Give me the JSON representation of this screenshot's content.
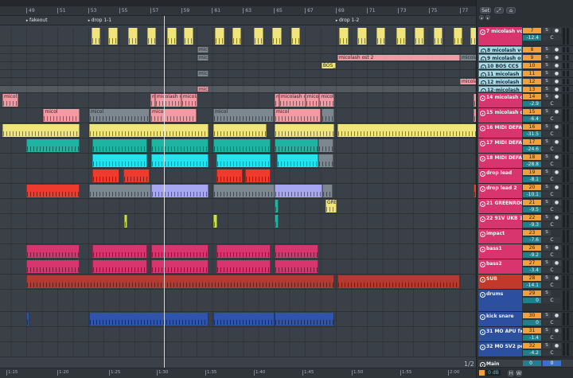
{
  "colors": {
    "yellow": "#f0e57a",
    "gray": "#7d8790",
    "pink": "#f49aa4",
    "teal": "#1db5a2",
    "cyan": "#22e3ef",
    "red": "#ef3b2e",
    "lavender": "#a7a6f0",
    "darkred": "#b33b2f",
    "blue": "#2f54aa",
    "lime": "#c8e04a",
    "hdr_pink": "#d8356f",
    "hdr_lightblue": "#a8dce9",
    "hdr_red": "#c0392b",
    "hdr_blue": "#2d4fa0"
  },
  "ruler": {
    "bars": [
      "49",
      "51",
      "53",
      "55",
      "57",
      "59",
      "61",
      "63",
      "65",
      "67",
      "69",
      "71",
      "73",
      "75",
      "77"
    ]
  },
  "locators": [
    {
      "name": "fakeout",
      "bar": 49.2
    },
    {
      "name": "drop 1-1",
      "bar": 53.2
    },
    {
      "name": "drop 1-2",
      "bar": 69.2
    }
  ],
  "timebar": {
    "labels": [
      "1:15",
      "1:20",
      "1:25",
      "1:30",
      "1:35",
      "1:40",
      "1:45",
      "1:50",
      "1:55",
      "2:00"
    ],
    "zoom": "1/2"
  },
  "panel": {
    "set_label": "Set",
    "expand_icon": "expand-icon",
    "lock_icon": "lock-icon",
    "nav_left": "◂",
    "nav_right": "▸"
  },
  "tracks": [
    {
      "name": "7 micolash voic",
      "num": "7",
      "vol": "-12.4",
      "pan": "C",
      "color": "hdr_pink",
      "fold": "down"
    },
    {
      "name": "8 micolash voic",
      "num": "8",
      "color": "hdr_lightblue",
      "fold": "right"
    },
    {
      "name": "9 micolash ost",
      "num": "9",
      "color": "hdr_lightblue",
      "fold": "right"
    },
    {
      "name": "10 BOS  CCS  12",
      "num": "10",
      "color": "hdr_lightblue",
      "fold": "right"
    },
    {
      "name": "11 micolash ost",
      "num": "11",
      "color": "hdr_lightblue",
      "fold": "right"
    },
    {
      "name": "12 micolash ost",
      "num": "12",
      "color": "hdr_lightblue",
      "fold": "right"
    },
    {
      "name": "12-micolash os",
      "num": "13",
      "color": "hdr_lightblue",
      "fold": "right"
    },
    {
      "name": "14 micolash ost",
      "num": "14",
      "vol": "-2.9",
      "pan": "C",
      "color": "hdr_pink",
      "fold": "down"
    },
    {
      "name": "15 micolash ost",
      "num": "15",
      "vol": "-6.4",
      "pan": "C",
      "color": "hdr_pink",
      "fold": "down"
    },
    {
      "name": "16 MIDI DEFAUL",
      "num": "16",
      "vol": "-31.5",
      "pan": "C",
      "color": "hdr_pink",
      "fold": "down"
    },
    {
      "name": "17 MIDI DEFAUL",
      "num": "17",
      "vol": "-24.6",
      "pan": "C",
      "color": "hdr_pink",
      "fold": "down"
    },
    {
      "name": "18 MIDI DEFAUL",
      "num": "18",
      "vol": "-28.8",
      "pan": "C",
      "color": "hdr_pink",
      "fold": "down"
    },
    {
      "name": "drop lead",
      "num": "19",
      "vol": "-8.1",
      "pan": "C",
      "color": "hdr_pink",
      "fold": "down"
    },
    {
      "name": "drop lead 2",
      "num": "20",
      "vol": "-10.1",
      "pan": "C",
      "color": "hdr_pink",
      "fold": "down"
    },
    {
      "name": "21 GREENROOM",
      "num": "21",
      "vol": "-9.5",
      "pan": "C",
      "color": "hdr_pink",
      "fold": "down"
    },
    {
      "name": "22 91V  UKB  14",
      "num": "22",
      "vol": "-9.3",
      "pan": "C",
      "color": "hdr_pink",
      "fold": "down"
    },
    {
      "name": "impact",
      "num": "23",
      "vol": "-7.6",
      "pan": "C",
      "color": "hdr_pink",
      "fold": "down",
      "noarm": true
    },
    {
      "name": "bass1",
      "num": "26",
      "vol": "-9.2",
      "pan": "C",
      "color": "hdr_pink",
      "fold": "down"
    },
    {
      "name": "bass2",
      "num": "27",
      "vol": "-3.4",
      "pan": "C",
      "color": "hdr_pink",
      "fold": "down"
    },
    {
      "name": "SUB",
      "num": "28",
      "vol": "-14.1",
      "pan": "C",
      "color": "hdr_red",
      "fold": "down"
    },
    {
      "name": "drums",
      "num": "29",
      "vol": "0",
      "pan": "C",
      "color": "hdr_blue",
      "fold": "down",
      "noarm": true
    },
    {
      "name": "kick snare",
      "num": "30",
      "vol": "0",
      "pan": "C",
      "color": "hdr_blue",
      "fold": "down"
    },
    {
      "name": "31 MO  APU  fx",
      "num": "31",
      "vol": "-1.4",
      "pan": "C",
      "color": "hdr_blue",
      "fold": "down"
    },
    {
      "name": "32 MO  SV2  pe",
      "num": "32",
      "vol": "-4.2",
      "pan": "C",
      "color": "hdr_blue",
      "fold": "down"
    }
  ],
  "main": {
    "name": "Main",
    "vol": "0",
    "pan": "0"
  },
  "footer": {
    "gain": "0 dB",
    "h": "H",
    "w": "W"
  },
  "clips": [
    {
      "t": 0,
      "s": 53.2,
      "l": 0.6,
      "c": "yellow"
    },
    {
      "t": 0,
      "s": 54.3,
      "l": 0.6,
      "c": "yellow"
    },
    {
      "t": 0,
      "s": 55.6,
      "l": 0.6,
      "c": "yellow"
    },
    {
      "t": 0,
      "s": 56.8,
      "l": 0.6,
      "c": "yellow"
    },
    {
      "t": 0,
      "s": 58.1,
      "l": 0.6,
      "c": "yellow"
    },
    {
      "t": 0,
      "s": 59.2,
      "l": 0.6,
      "c": "yellow"
    },
    {
      "t": 0,
      "s": 61.2,
      "l": 0.6,
      "c": "yellow"
    },
    {
      "t": 0,
      "s": 62.3,
      "l": 0.6,
      "c": "yellow"
    },
    {
      "t": 0,
      "s": 63.7,
      "l": 0.6,
      "c": "yellow"
    },
    {
      "t": 0,
      "s": 64.9,
      "l": 0.6,
      "c": "yellow"
    },
    {
      "t": 0,
      "s": 66.1,
      "l": 0.6,
      "c": "yellow"
    },
    {
      "t": 0,
      "s": 69.2,
      "l": 0.6,
      "c": "yellow"
    },
    {
      "t": 0,
      "s": 70.4,
      "l": 0.6,
      "c": "yellow"
    },
    {
      "t": 0,
      "s": 71.6,
      "l": 0.6,
      "c": "yellow"
    },
    {
      "t": 0,
      "s": 72.9,
      "l": 0.6,
      "c": "yellow"
    },
    {
      "t": 0,
      "s": 74.1,
      "l": 0.6,
      "c": "yellow"
    },
    {
      "t": 0,
      "s": 75.3,
      "l": 0.6,
      "c": "yellow"
    },
    {
      "t": 0,
      "s": 76.6,
      "l": 0.6,
      "c": "yellow"
    },
    {
      "t": 0,
      "s": 77.7,
      "l": 0.6,
      "c": "yellow"
    },
    {
      "t": 1,
      "s": 60.05,
      "l": 0.72,
      "c": "gray",
      "name": "micol"
    },
    {
      "t": 2,
      "s": 60.05,
      "l": 0.72,
      "c": "gray",
      "name": "micol"
    },
    {
      "t": 2,
      "s": 69.1,
      "l": 7.92,
      "c": "pink",
      "name": "micolash ost 2"
    },
    {
      "t": 2,
      "s": 77.02,
      "l": 1.1,
      "c": "gray",
      "name": "micolas"
    },
    {
      "t": 3,
      "s": 68.07,
      "l": 0.93,
      "c": "yellow",
      "name": "BOS_C"
    },
    {
      "t": 4,
      "s": 60.05,
      "l": 0.72,
      "c": "gray",
      "name": "micol"
    },
    {
      "t": 5,
      "s": 77.02,
      "l": 1.1,
      "c": "pink",
      "name": "micolas"
    },
    {
      "t": 6,
      "s": 60.05,
      "l": 0.72,
      "c": "pink",
      "name": "micol"
    },
    {
      "t": 7,
      "s": 47.46,
      "l": 1.03,
      "c": "pink",
      "name": "micol"
    },
    {
      "t": 7,
      "s": 57.02,
      "l": 0.3,
      "c": "pink",
      "name": "m"
    },
    {
      "t": 7,
      "s": 57.32,
      "l": 1.7,
      "c": "pink",
      "name": "micolash ost"
    },
    {
      "t": 7,
      "s": 59.02,
      "l": 1.03,
      "c": "pink",
      "name": "micolas"
    },
    {
      "t": 7,
      "s": 65.04,
      "l": 0.3,
      "c": "pink",
      "name": "m"
    },
    {
      "t": 7,
      "s": 65.34,
      "l": 1.7,
      "c": "pink",
      "name": "micolash ost"
    },
    {
      "t": 7,
      "s": 67.04,
      "l": 0.9,
      "c": "pink",
      "name": "micolas"
    },
    {
      "t": 7,
      "s": 67.94,
      "l": 0.96,
      "c": "pink",
      "name": "micolas"
    },
    {
      "t": 7,
      "s": 77.9,
      "l": 0.3,
      "c": "pink"
    },
    {
      "t": 8,
      "s": 50.1,
      "l": 2.34,
      "c": "pink",
      "name": "micol"
    },
    {
      "t": 8,
      "s": 53.06,
      "l": 3.9,
      "c": "gray",
      "name": "micol"
    },
    {
      "t": 8,
      "s": 57.02,
      "l": 3.0,
      "c": "pink",
      "name": "micol"
    },
    {
      "t": 8,
      "s": 61.08,
      "l": 3.9,
      "c": "gray",
      "name": "micol"
    },
    {
      "t": 8,
      "s": 65.04,
      "l": 3.0,
      "c": "pink",
      "name": "micol"
    },
    {
      "t": 8,
      "s": 68.1,
      "l": 0.8,
      "c": "gray"
    },
    {
      "t": 8,
      "s": 77.9,
      "l": 0.3,
      "c": "pink"
    },
    {
      "t": 9,
      "s": 47.46,
      "l": 4.98,
      "c": "yellow"
    },
    {
      "t": 9,
      "s": 53.06,
      "l": 7.71,
      "c": "yellow"
    },
    {
      "t": 9,
      "s": 61.08,
      "l": 3.45,
      "c": "yellow"
    },
    {
      "t": 9,
      "s": 65.04,
      "l": 3.86,
      "c": "yellow"
    },
    {
      "t": 9,
      "s": 69.1,
      "l": 9.0,
      "c": "yellow"
    },
    {
      "t": 10,
      "s": 49,
      "l": 3.44,
      "c": "teal"
    },
    {
      "t": 10,
      "s": 53.27,
      "l": 3.54,
      "c": "teal"
    },
    {
      "t": 10,
      "s": 57.07,
      "l": 3.7,
      "c": "teal"
    },
    {
      "t": 10,
      "s": 61.08,
      "l": 3.7,
      "c": "teal"
    },
    {
      "t": 10,
      "s": 65.04,
      "l": 2.83,
      "c": "teal"
    },
    {
      "t": 10,
      "s": 67.87,
      "l": 1.0,
      "c": "gray"
    },
    {
      "t": 11,
      "s": 53.27,
      "l": 3.54,
      "c": "cyan"
    },
    {
      "t": 11,
      "s": 57.07,
      "l": 3.7,
      "c": "cyan"
    },
    {
      "t": 11,
      "s": 61.29,
      "l": 3.49,
      "c": "cyan"
    },
    {
      "t": 11,
      "s": 65.2,
      "l": 2.67,
      "c": "cyan"
    },
    {
      "t": 11,
      "s": 67.87,
      "l": 1.0,
      "c": "gray"
    },
    {
      "t": 12,
      "s": 53.27,
      "l": 1.75,
      "c": "red"
    },
    {
      "t": 12,
      "s": 55.27,
      "l": 1.7,
      "c": "red"
    },
    {
      "t": 12,
      "s": 61.29,
      "l": 1.69,
      "c": "red"
    },
    {
      "t": 12,
      "s": 63.14,
      "l": 1.64,
      "c": "red"
    },
    {
      "t": 13,
      "s": 49,
      "l": 3.44,
      "c": "red"
    },
    {
      "t": 13,
      "s": 53.06,
      "l": 4.0,
      "c": "gray"
    },
    {
      "t": 13,
      "s": 57.07,
      "l": 3.7,
      "c": "lavender"
    },
    {
      "t": 13,
      "s": 61.08,
      "l": 3.96,
      "c": "gray"
    },
    {
      "t": 13,
      "s": 65.04,
      "l": 3.09,
      "c": "lavender"
    },
    {
      "t": 13,
      "s": 68.13,
      "l": 0.67,
      "c": "gray"
    },
    {
      "t": 13,
      "s": 77.9,
      "l": 0.6,
      "c": "red"
    },
    {
      "t": 14,
      "s": 68.33,
      "l": 0.7,
      "c": "yellow",
      "name": "GREE"
    },
    {
      "t": 14,
      "s": 65.04,
      "l": 0.25,
      "c": "teal"
    },
    {
      "t": 15,
      "s": 55.3,
      "l": 0.25,
      "c": "lime"
    },
    {
      "t": 15,
      "s": 61.08,
      "l": 0.25,
      "c": "lime"
    },
    {
      "t": 15,
      "s": 65.04,
      "l": 0.25,
      "c": "teal"
    },
    {
      "t": 17,
      "s": 49,
      "l": 3.44,
      "c": "hdr_pink"
    },
    {
      "t": 17,
      "s": 53.27,
      "l": 3.54,
      "c": "hdr_pink"
    },
    {
      "t": 17,
      "s": 57.07,
      "l": 3.7,
      "c": "hdr_pink"
    },
    {
      "t": 17,
      "s": 61.29,
      "l": 3.49,
      "c": "hdr_pink"
    },
    {
      "t": 17,
      "s": 65.04,
      "l": 2.83,
      "c": "hdr_pink"
    },
    {
      "t": 18,
      "s": 49,
      "l": 3.44,
      "c": "hdr_pink"
    },
    {
      "t": 18,
      "s": 53.27,
      "l": 3.54,
      "c": "hdr_pink"
    },
    {
      "t": 18,
      "s": 57.07,
      "l": 3.7,
      "c": "hdr_pink"
    },
    {
      "t": 18,
      "s": 61.29,
      "l": 3.49,
      "c": "hdr_pink"
    },
    {
      "t": 18,
      "s": 65.04,
      "l": 2.83,
      "c": "hdr_pink"
    },
    {
      "t": 19,
      "s": 49,
      "l": 19.9,
      "c": "darkred"
    },
    {
      "t": 19,
      "s": 69.1,
      "l": 7.92,
      "c": "darkred"
    },
    {
      "t": 21,
      "s": 49,
      "l": 0.2,
      "c": "blue"
    },
    {
      "t": 21,
      "s": 53.06,
      "l": 7.71,
      "c": "blue"
    },
    {
      "t": 21,
      "s": 61.08,
      "l": 3.96,
      "c": "blue"
    },
    {
      "t": 21,
      "s": 65.04,
      "l": 3.86,
      "c": "blue"
    }
  ]
}
